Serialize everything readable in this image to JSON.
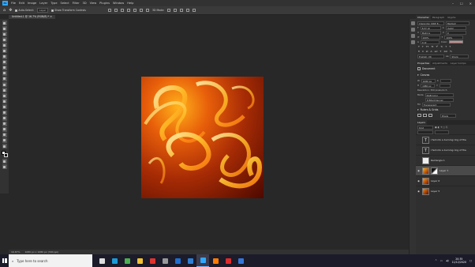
{
  "menubar": {
    "app_logo": "Ps",
    "items": [
      "File",
      "Edit",
      "Image",
      "Layer",
      "Type",
      "Select",
      "Filter",
      "3D",
      "View",
      "Plugins",
      "Window",
      "Help"
    ],
    "window_controls": [
      "–",
      "☐",
      "✕"
    ]
  },
  "options": {
    "auto_select_label": "Auto-Select:",
    "auto_select_value": "Layer",
    "show_transform_label": "Show Transform Controls",
    "mode_3d_label": "3D Mode:"
  },
  "document": {
    "tab_label": "Untitled-1 @ 16.7% (RGB/8) *",
    "close_glyph": "×"
  },
  "status": {
    "zoom": "16.67%",
    "doc_size": "1080 px x 1080 px (300 ppi)"
  },
  "character_panel": {
    "tabs": [
      "Character",
      "Paragraph",
      "Glyphs"
    ],
    "font_family": "Clarendon URW E...",
    "font_style": "Medium",
    "font_size": "8.37 pt",
    "leading": "(Auto)",
    "kerning": "Metrics",
    "tracking": "0",
    "vscale": "100%",
    "hscale": "100%",
    "baseline": "0 pt",
    "color_label": "Color:",
    "color_hex": "#c78b8b",
    "glyph_buttons": [
      "T",
      "T",
      "TT",
      "Tt",
      "T¹",
      "T₁",
      "T",
      "T"
    ],
    "language": "English: UK",
    "aa": "Sharp"
  },
  "properties_panel": {
    "tabs": [
      "Properties",
      "Adjustments",
      "Layer Comps"
    ],
    "doc_label": "Document",
    "canvas_heading": "Canvas",
    "w_label": "W",
    "w_value": "1080 px",
    "h_label": "H",
    "h_value": "1080 px",
    "x_label": "X",
    "y_label": "Y",
    "resolution": "Resolution: 300 pixels/inch",
    "mode_label": "Mode",
    "mode_value": "RGB Color",
    "depth_value": "8 Bits/Channel",
    "fill_label": "Fill",
    "fill_value": "Transparent",
    "rulers_heading": "Rulers & Grids",
    "units_value": "Pixels"
  },
  "layers_panel": {
    "title": "Layers",
    "kind_label": "Kind",
    "layers": [
      {
        "name": "I fell into a burning ring of fire",
        "type": "text",
        "visible": false
      },
      {
        "name": "I fell into a burning ring of fire",
        "type": "text",
        "visible": false
      },
      {
        "name": "Rectangle 1",
        "type": "shape",
        "visible": false
      },
      {
        "name": "Layer 7",
        "type": "pixel-mask",
        "visible": true
      },
      {
        "name": "Layer 6",
        "type": "pixel",
        "visible": true
      },
      {
        "name": "Layer 5",
        "type": "pixel",
        "visible": true
      }
    ]
  },
  "taskbar": {
    "search_placeholder": "Type here to search",
    "apps": [
      {
        "name": "Task View",
        "color": "#dddddd"
      },
      {
        "name": "Edge",
        "color": "#1a9bd7"
      },
      {
        "name": "Chrome",
        "color": "#4caf50"
      },
      {
        "name": "Explorer",
        "color": "#f1c232"
      },
      {
        "name": "Opera",
        "color": "#e0332c"
      },
      {
        "name": "Settings",
        "color": "#999999"
      },
      {
        "name": "Outlook",
        "color": "#1f6fd1"
      },
      {
        "name": "Photos",
        "color": "#2d7fd3"
      },
      {
        "name": "Photoshop",
        "color": "#31a8ff"
      },
      {
        "name": "Illustrator",
        "color": "#ff7c00"
      },
      {
        "name": "Acrobat",
        "color": "#e02b2b"
      },
      {
        "name": "Mail",
        "color": "#3476d8"
      }
    ],
    "time": "20:35",
    "date": "11/12/2020"
  }
}
